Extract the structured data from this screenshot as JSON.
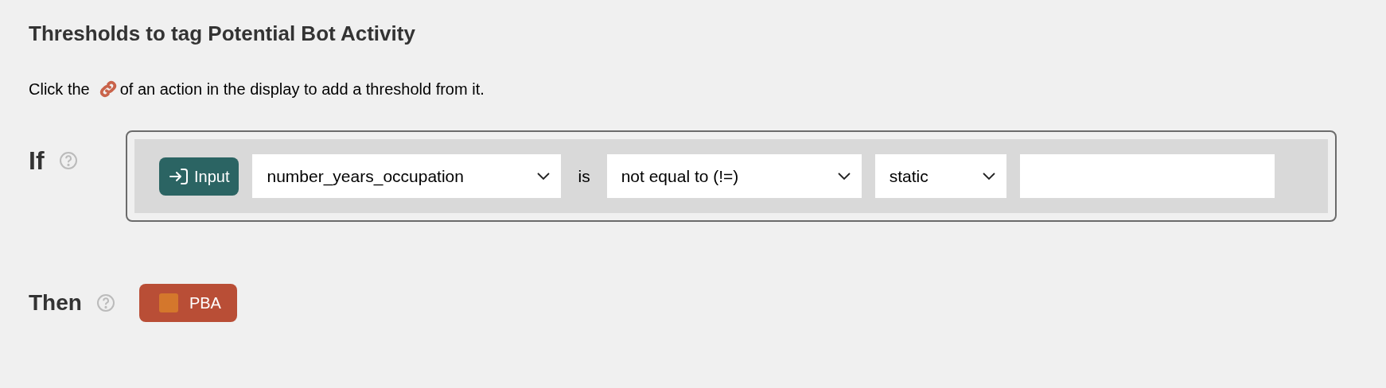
{
  "title": "Thresholds to tag Potential Bot Activity",
  "intro": {
    "before_icon": "Click the",
    "after_icon": "of an action in the display to add a threshold from it."
  },
  "condition": {
    "label": "If",
    "source_chip": "Input",
    "field": {
      "value": "number_years_occupation"
    },
    "verb": "is",
    "operator": {
      "value": "not equal to (!=)"
    },
    "value_type": {
      "value": "static"
    }
  },
  "action": {
    "label": "Then",
    "tags": [
      {
        "label": "PBA",
        "color": "#d4772c"
      }
    ]
  }
}
